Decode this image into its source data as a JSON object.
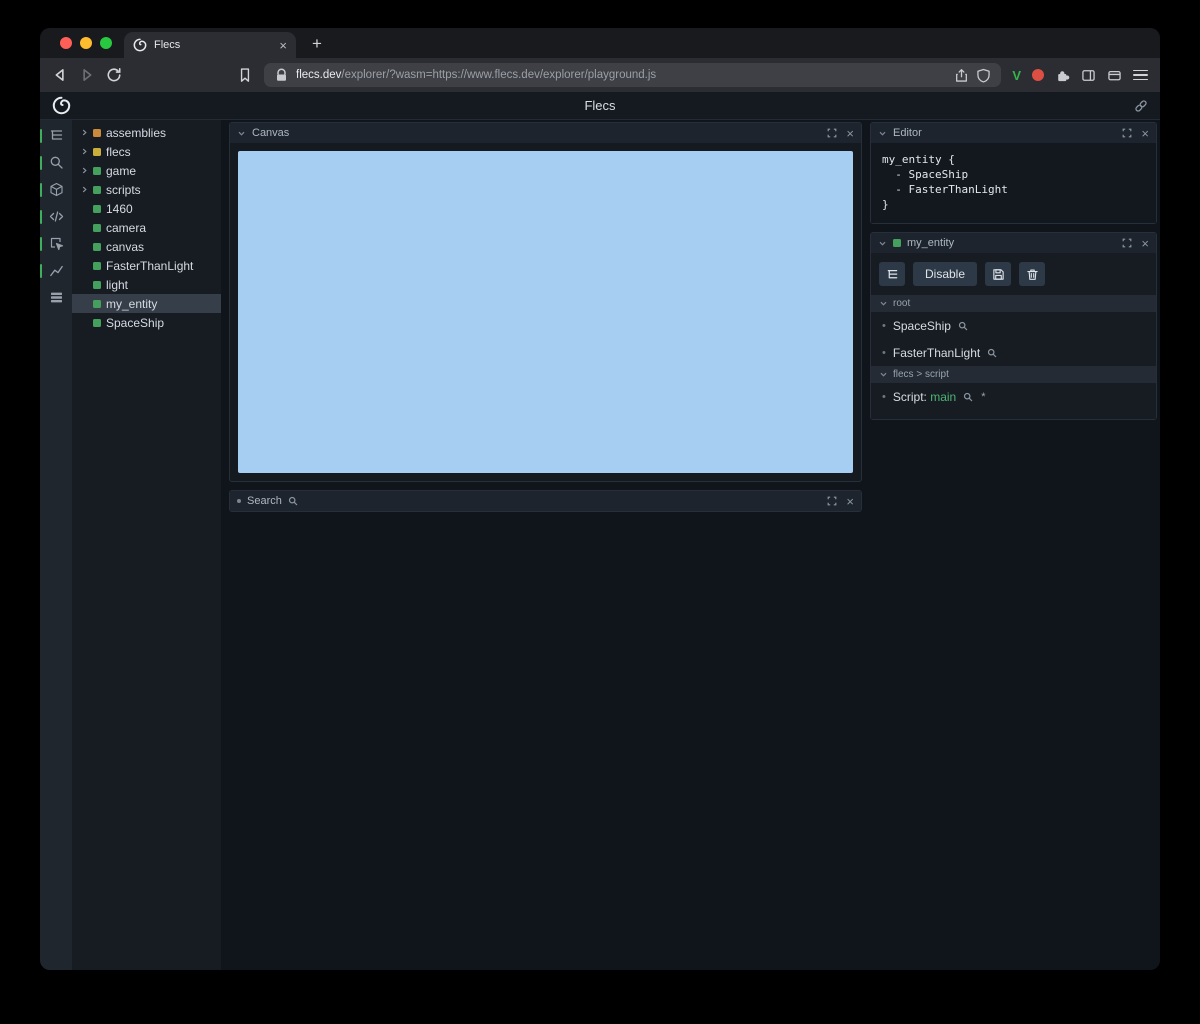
{
  "colors": {
    "accent_green": "#3fae5f",
    "canvas_blue": "#a6cdf2",
    "traffic": [
      "#ff5f57",
      "#febc2e",
      "#28c840"
    ]
  },
  "ui": {
    "close": "×",
    "bullet": "•",
    "star": "*"
  },
  "browser": {
    "tab_title": "Flecs",
    "new_tab_label": "+",
    "url_domain": "flecs.dev",
    "url_path": "/explorer/?wasm=https://www.flecs.dev/explorer/playground.js",
    "extension_v_label": "V"
  },
  "app": {
    "title": "Flecs"
  },
  "sidebar": {
    "icons": [
      "entity-tree",
      "search",
      "components",
      "code",
      "inspector",
      "stats",
      "logs"
    ]
  },
  "tree": {
    "items": [
      {
        "label": "assemblies",
        "expandable": true,
        "color": "#c98a3b",
        "selected": false
      },
      {
        "label": "flecs",
        "expandable": true,
        "color": "#c9ae3b",
        "selected": false
      },
      {
        "label": "game",
        "expandable": true,
        "color": "#44a05c",
        "selected": false
      },
      {
        "label": "scripts",
        "expandable": true,
        "color": "#44a05c",
        "selected": false
      },
      {
        "label": "1460",
        "expandable": false,
        "color": "#44a05c",
        "selected": false
      },
      {
        "label": "camera",
        "expandable": false,
        "color": "#44a05c",
        "selected": false
      },
      {
        "label": "canvas",
        "expandable": false,
        "color": "#44a05c",
        "selected": false
      },
      {
        "label": "FasterThanLight",
        "expandable": false,
        "color": "#44a05c",
        "selected": false
      },
      {
        "label": "light",
        "expandable": false,
        "color": "#44a05c",
        "selected": false
      },
      {
        "label": "my_entity",
        "expandable": false,
        "color": "#44a05c",
        "selected": true
      },
      {
        "label": "SpaceShip",
        "expandable": false,
        "color": "#44a05c",
        "selected": false
      }
    ]
  },
  "panels": {
    "canvas": {
      "title": "Canvas"
    },
    "search": {
      "title": "Search"
    },
    "editor": {
      "title": "Editor",
      "code_lines": [
        "my_entity {",
        "  - SpaceShip",
        "  - FasterThanLight",
        "}"
      ]
    },
    "entity": {
      "title": "my_entity",
      "color": "#44a05c",
      "disable_label": "Disable",
      "sections": [
        {
          "title": "root",
          "items": [
            {
              "text": "SpaceShip"
            },
            {
              "text": "FasterThanLight"
            }
          ]
        },
        {
          "title": "flecs > script",
          "items": [
            {
              "prefix": "Script: ",
              "value": "main"
            }
          ]
        }
      ]
    }
  }
}
